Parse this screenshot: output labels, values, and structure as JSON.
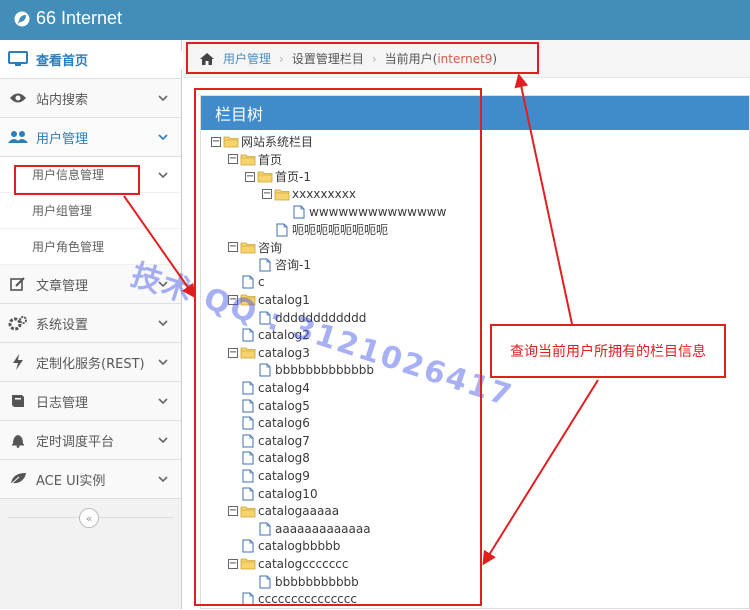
{
  "app": {
    "title": "66 Internet"
  },
  "sidebar": {
    "items": [
      {
        "label": "查看首页",
        "icon": "monitor-icon",
        "state": "active"
      },
      {
        "label": "站内搜索",
        "icon": "eye-icon",
        "state": "normal"
      },
      {
        "label": "用户管理",
        "icon": "users-icon",
        "state": "open"
      },
      {
        "label": "文章管理",
        "icon": "pencil-square-icon",
        "state": "normal"
      },
      {
        "label": "系统设置",
        "icon": "cogs-icon",
        "state": "normal"
      },
      {
        "label": "定制化服务(REST)",
        "icon": "bolt-icon",
        "state": "normal"
      },
      {
        "label": "日志管理",
        "icon": "book-icon",
        "state": "normal"
      },
      {
        "label": "定时调度平台",
        "icon": "bell-icon",
        "state": "normal"
      },
      {
        "label": "ACE UI实例",
        "icon": "leaf-icon",
        "state": "normal"
      }
    ],
    "subitems": [
      "用户信息管理",
      "用户组管理",
      "用户角色管理"
    ],
    "collapse_glyph": "«"
  },
  "breadcrumb": {
    "home_label": "用户管理",
    "sep": "›",
    "second": "设置管理栏目",
    "current_prefix": "当前用户(",
    "current_user": "internet9",
    "current_suffix": ")"
  },
  "widget": {
    "title": "栏目树"
  },
  "tree": [
    {
      "label": "网站系统栏目",
      "level": 0,
      "type": "folder-open",
      "switch": "−"
    },
    {
      "label": "首页",
      "level": 1,
      "type": "folder-open",
      "switch": "−"
    },
    {
      "label": "首页-1",
      "level": 2,
      "type": "folder-open",
      "switch": "−"
    },
    {
      "label": "xxxxxxxxx",
      "level": 3,
      "type": "folder-open",
      "switch": "−"
    },
    {
      "label": "wwwwwwwwwwwwww",
      "level": 4,
      "type": "file",
      "switch": ""
    },
    {
      "label": "呃呃呃呃呃呃呃呃",
      "level": 3,
      "type": "file",
      "switch": ""
    },
    {
      "label": "咨询",
      "level": 1,
      "type": "folder-open",
      "switch": "−"
    },
    {
      "label": "咨询-1",
      "level": 2,
      "type": "file",
      "switch": ""
    },
    {
      "label": "c",
      "level": 1,
      "type": "file",
      "switch": ""
    },
    {
      "label": "catalog1",
      "level": 1,
      "type": "folder-open",
      "switch": "−"
    },
    {
      "label": "dddddddddddd",
      "level": 2,
      "type": "file",
      "switch": ""
    },
    {
      "label": "catalog2",
      "level": 1,
      "type": "file",
      "switch": ""
    },
    {
      "label": "catalog3",
      "level": 1,
      "type": "folder-open",
      "switch": "−"
    },
    {
      "label": "bbbbbbbbbbbbb",
      "level": 2,
      "type": "file",
      "switch": ""
    },
    {
      "label": "catalog4",
      "level": 1,
      "type": "file",
      "switch": ""
    },
    {
      "label": "catalog5",
      "level": 1,
      "type": "file",
      "switch": ""
    },
    {
      "label": "catalog6",
      "level": 1,
      "type": "file",
      "switch": ""
    },
    {
      "label": "catalog7",
      "level": 1,
      "type": "file",
      "switch": ""
    },
    {
      "label": "catalog8",
      "level": 1,
      "type": "file",
      "switch": ""
    },
    {
      "label": "catalog9",
      "level": 1,
      "type": "file",
      "switch": ""
    },
    {
      "label": "catalog10",
      "level": 1,
      "type": "file",
      "switch": ""
    },
    {
      "label": "catalogaaaaa",
      "level": 1,
      "type": "folder-open",
      "switch": "−"
    },
    {
      "label": "aaaaaaaaaaaaa",
      "level": 2,
      "type": "file",
      "switch": ""
    },
    {
      "label": "catalogbbbbb",
      "level": 1,
      "type": "file",
      "switch": ""
    },
    {
      "label": "catalogccccccc",
      "level": 1,
      "type": "folder-open",
      "switch": "−"
    },
    {
      "label": "bbbbbbbbbbb",
      "level": 2,
      "type": "file",
      "switch": ""
    },
    {
      "label": "ccccccccccccccc",
      "level": 1,
      "type": "file",
      "switch": ""
    }
  ],
  "annotation": {
    "text": "查询当前用户所拥有的栏目信息"
  },
  "watermark": {
    "text": "技术 QQ : 3121026417"
  },
  "colors": {
    "topbar": "#438EB9",
    "widget_head": "#428BCA",
    "annotation": "#E02020",
    "link": "#4C8FBD"
  }
}
